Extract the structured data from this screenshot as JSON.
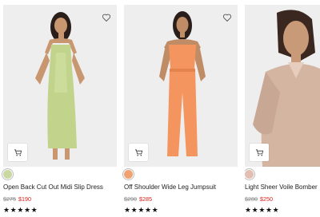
{
  "products": [
    {
      "name": "Open Back Cut Out Midi Slip Dress",
      "old_price": "$275",
      "sale_price": "$190",
      "swatch_color": "#c9d7a0",
      "rating_stars": "★★★★★"
    },
    {
      "name": "Off Shoulder Wide Leg Jumpsuit",
      "old_price": "$290",
      "sale_price": "$285",
      "swatch_color": "#f0a272",
      "rating_stars": "★★★★★"
    },
    {
      "name": "Light Sheer Voile Bomber",
      "old_price": "$280",
      "sale_price": "$250",
      "swatch_color": "#e2bfb2",
      "rating_stars": "★★★★★"
    }
  ],
  "colors": {
    "image_bg": "#eeeeef",
    "sale_red": "#d8201c",
    "old_price_grey": "#8d8d8d"
  },
  "icons": [
    "heart-icon",
    "cart-icon"
  ]
}
